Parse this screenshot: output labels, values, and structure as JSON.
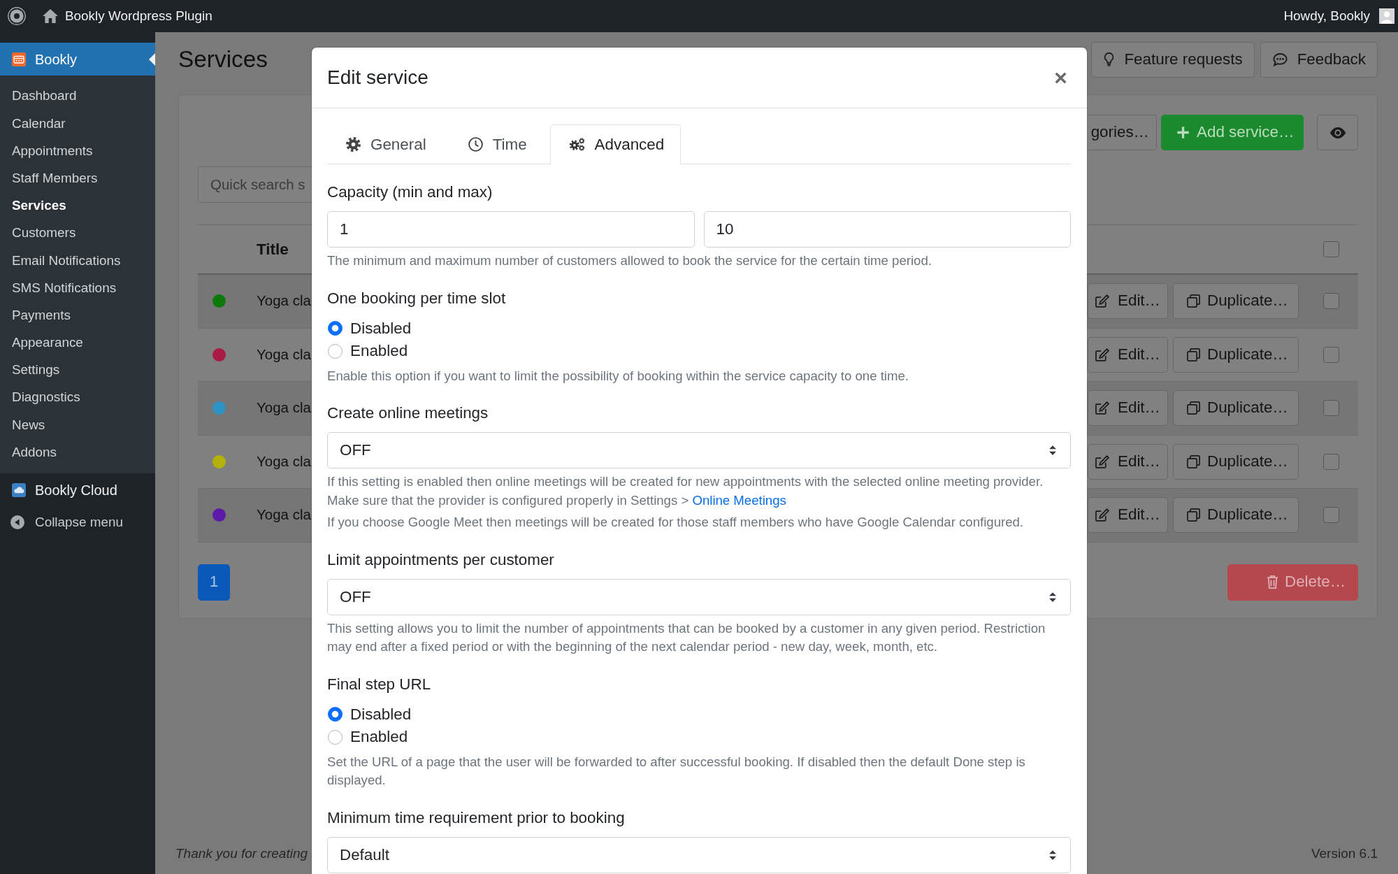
{
  "admin_bar": {
    "site_name": "Bookly Wordpress Plugin",
    "greeting": "Howdy, Bookly"
  },
  "sidebar": {
    "plugin_menu": {
      "label": "Bookly",
      "selected": true,
      "children": [
        {
          "label": "Dashboard",
          "selected": false
        },
        {
          "label": "Calendar",
          "selected": false
        },
        {
          "label": "Appointments",
          "selected": false
        },
        {
          "label": "Staff Members",
          "selected": false
        },
        {
          "label": "Services",
          "selected": true
        },
        {
          "label": "Customers",
          "selected": false
        },
        {
          "label": "Email Notifications",
          "selected": false
        },
        {
          "label": "SMS Notifications",
          "selected": false
        },
        {
          "label": "Payments",
          "selected": false
        },
        {
          "label": "Appearance",
          "selected": false
        },
        {
          "label": "Settings",
          "selected": false
        },
        {
          "label": "Diagnostics",
          "selected": false
        },
        {
          "label": "News",
          "selected": false
        },
        {
          "label": "Addons",
          "selected": false
        }
      ]
    },
    "cloud_menu": {
      "label": "Bookly Cloud",
      "selected": false
    },
    "collapse_label": "Collapse menu"
  },
  "page": {
    "title": "Services",
    "header_buttons": [
      "Feature requests",
      "Feedback"
    ],
    "categories_button": "gories…",
    "add_button": "Add service…",
    "search": {
      "placeholder": "Quick search s"
    },
    "table": {
      "title_column": "Title",
      "select_all_checked": false,
      "rows": [
        {
          "color": "#0b7a0b",
          "title": "Yoga cla",
          "edit": "Edit…",
          "duplicate": "Duplicate…",
          "checked": false
        },
        {
          "color": "#a81b44",
          "title": "Yoga cla",
          "edit": "Edit…",
          "duplicate": "Duplicate…",
          "checked": false
        },
        {
          "color": "#2c93c2",
          "title": "Yoga cla",
          "edit": "Edit…",
          "duplicate": "Duplicate…",
          "checked": false
        },
        {
          "color": "#b3b10a",
          "title": "Yoga cla",
          "edit": "Edit…",
          "duplicate": "Duplicate…",
          "checked": false
        },
        {
          "color": "#5c1aa7",
          "title": "Yoga cla",
          "edit": "Edit…",
          "duplicate": "Duplicate…",
          "checked": false
        }
      ]
    },
    "pagination": [
      {
        "label": "1",
        "selected": true
      }
    ],
    "delete_button": {
      "label": "Delete…",
      "disabled": true
    },
    "footer": {
      "thanks": "Thank you for creating",
      "version": "Version 6.1"
    }
  },
  "modal": {
    "title": "Edit service",
    "tabs": [
      {
        "label": "General",
        "selected": false
      },
      {
        "label": "Time",
        "selected": false
      },
      {
        "label": "Advanced",
        "selected": true
      }
    ],
    "fields": [
      {
        "kind": "range",
        "label": "Capacity (min and max)",
        "values": [
          "1",
          "10"
        ],
        "help": [
          {
            "text": "The minimum and maximum number of customers allowed to book the service for the certain time period."
          }
        ]
      },
      {
        "kind": "radio",
        "label": "One booking per time slot",
        "options": [
          {
            "label": "Disabled",
            "selected": true
          },
          {
            "label": "Enabled",
            "selected": false
          }
        ],
        "help": [
          {
            "text": "Enable this option if you want to limit the possibility of booking within the service capacity to one time."
          }
        ]
      },
      {
        "kind": "select",
        "label": "Create online meetings",
        "value": "OFF",
        "help": [
          {
            "text": "If this setting is enabled then online meetings will be created for new appointments with the selected online meeting provider. Make sure that the provider is configured properly in Settings > ",
            "link": "Online Meetings"
          },
          {
            "text": "If you choose Google Meet then meetings will be created for those staff members who have Google Calendar configured."
          }
        ]
      },
      {
        "kind": "select",
        "label": "Limit appointments per customer",
        "value": "OFF",
        "help": [
          {
            "text": "This setting allows you to limit the number of appointments that can be booked by a customer in any given period. Restriction may end after a fixed period or with the beginning of the next calendar period - new day, week, month, etc."
          }
        ]
      },
      {
        "kind": "radio",
        "label": "Final step URL",
        "options": [
          {
            "label": "Disabled",
            "selected": true
          },
          {
            "label": "Enabled",
            "selected": false
          }
        ],
        "help": [
          {
            "text": "Set the URL of a page that the user will be forwarded to after successful booking. If disabled then the default Done step is displayed."
          }
        ]
      },
      {
        "kind": "select",
        "label": "Minimum time requirement prior to booking",
        "value": "Default"
      }
    ]
  }
}
